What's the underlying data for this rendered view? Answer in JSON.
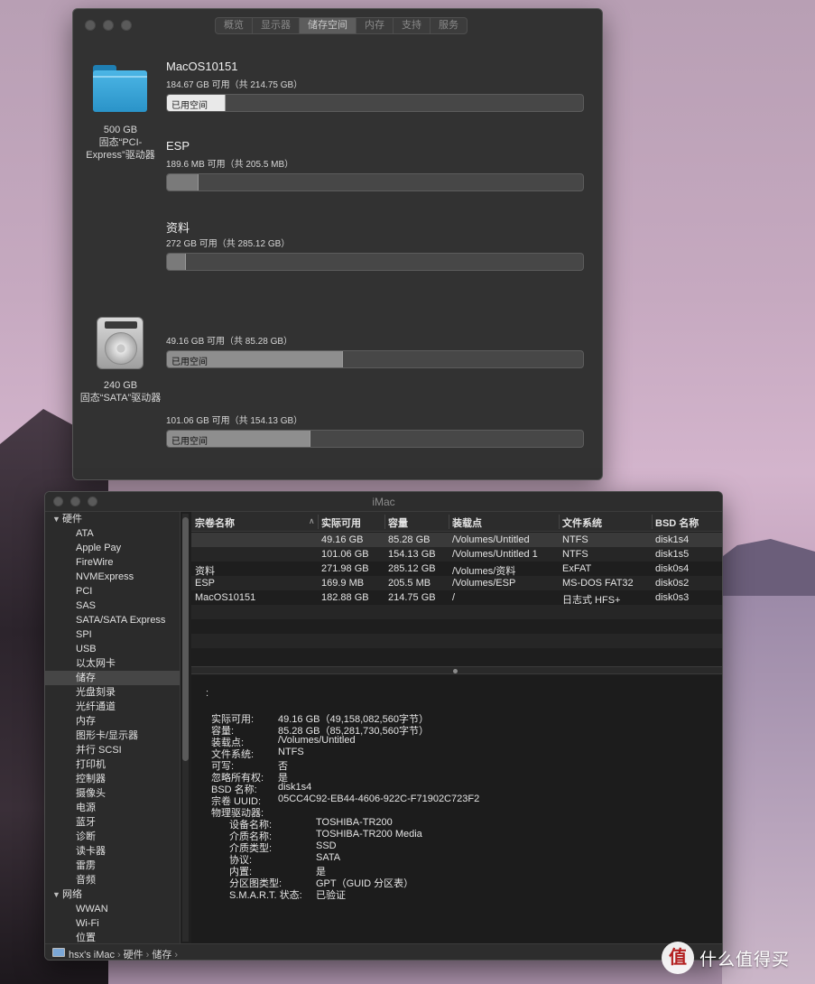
{
  "about": {
    "tabs": [
      "概览",
      "显示器",
      "储存空间",
      "内存",
      "支持",
      "服务"
    ],
    "active_tab": "储存空间",
    "drives": [
      {
        "caption_lines": [
          "500 GB",
          "固态“PCI-",
          "Express”驱动器"
        ],
        "icon": "folder-icon",
        "volumes": [
          {
            "name": "MacOS10151",
            "available": "184.67 GB 可用（共 214.75 GB）",
            "used_label": "已用空间",
            "used_fraction": 0.14
          },
          {
            "name": "ESP",
            "available": "189.6 MB 可用（共 205.5 MB）",
            "used_label": "",
            "used_fraction": 0.077
          },
          {
            "name": "资料",
            "available": "272 GB 可用（共 285.12 GB）",
            "used_label": "",
            "used_fraction": 0.046
          }
        ]
      },
      {
        "caption_lines": [
          "240 GB",
          "固态“SATA”驱动器"
        ],
        "icon": "hard-drive-icon",
        "volumes": [
          {
            "name": "",
            "available": "49.16 GB 可用（共 85.28 GB）",
            "used_label": "已用空间",
            "used_fraction": 0.424
          },
          {
            "name": "",
            "available": "101.06 GB 可用（共 154.13 GB）",
            "used_label": "已用空间",
            "used_fraction": 0.344
          }
        ]
      }
    ]
  },
  "sysinfo": {
    "title": "iMac",
    "sidebar": [
      {
        "label": "硬件",
        "type": "group"
      },
      {
        "label": "ATA",
        "type": "item"
      },
      {
        "label": "Apple Pay",
        "type": "item"
      },
      {
        "label": "FireWire",
        "type": "item"
      },
      {
        "label": "NVMExpress",
        "type": "item"
      },
      {
        "label": "PCI",
        "type": "item"
      },
      {
        "label": "SAS",
        "type": "item"
      },
      {
        "label": "SATA/SATA Express",
        "type": "item"
      },
      {
        "label": "SPI",
        "type": "item"
      },
      {
        "label": "USB",
        "type": "item"
      },
      {
        "label": "以太网卡",
        "type": "item"
      },
      {
        "label": "储存",
        "type": "item",
        "selected": true
      },
      {
        "label": "光盘刻录",
        "type": "item"
      },
      {
        "label": "光纤通道",
        "type": "item"
      },
      {
        "label": "内存",
        "type": "item"
      },
      {
        "label": "图形卡/显示器",
        "type": "item"
      },
      {
        "label": "并行 SCSI",
        "type": "item"
      },
      {
        "label": "打印机",
        "type": "item"
      },
      {
        "label": "控制器",
        "type": "item"
      },
      {
        "label": "摄像头",
        "type": "item"
      },
      {
        "label": "电源",
        "type": "item"
      },
      {
        "label": "蓝牙",
        "type": "item"
      },
      {
        "label": "诊断",
        "type": "item"
      },
      {
        "label": "读卡器",
        "type": "item"
      },
      {
        "label": "雷雳",
        "type": "item"
      },
      {
        "label": "音频",
        "type": "item"
      },
      {
        "label": "网络",
        "type": "group"
      },
      {
        "label": "WWAN",
        "type": "item"
      },
      {
        "label": "Wi-Fi",
        "type": "item"
      },
      {
        "label": "位置",
        "type": "item"
      }
    ],
    "table": {
      "columns": [
        "宗卷名称",
        "实际可用",
        "容量",
        "装载点",
        "文件系统",
        "BSD 名称"
      ],
      "rows": [
        [
          "",
          "49.16 GB",
          "85.28 GB",
          "/Volumes/Untitled",
          "NTFS",
          "disk1s4"
        ],
        [
          "",
          "101.06 GB",
          "154.13 GB",
          "/Volumes/Untitled 1",
          "NTFS",
          "disk1s5"
        ],
        [
          "资料",
          "271.98 GB",
          "285.12 GB",
          "/Volumes/资料",
          "ExFAT",
          "disk0s4"
        ],
        [
          "ESP",
          "169.9 MB",
          "205.5 MB",
          "/Volumes/ESP",
          "MS-DOS FAT32",
          "disk0s2"
        ],
        [
          "MacOS10151",
          "182.88 GB",
          "214.75 GB",
          "/",
          "日志式 HFS+",
          "disk0s3"
        ]
      ],
      "selected_row": 0
    },
    "detail": {
      "heading": ":",
      "fields": [
        [
          "实际可用:",
          "49.16 GB（49,158,082,560字节）"
        ],
        [
          "容量:",
          "85.28 GB（85,281,730,560字节）"
        ],
        [
          "装载点:",
          "/Volumes/Untitled"
        ],
        [
          "文件系统:",
          "NTFS"
        ],
        [
          "可写:",
          "否"
        ],
        [
          "忽略所有权:",
          "是"
        ],
        [
          "BSD 名称:",
          "disk1s4"
        ],
        [
          "宗卷 UUID:",
          "05CC4C92-EB44-4606-922C-F71902C723F2"
        ],
        [
          "物理驱动器:",
          ""
        ]
      ],
      "physical": [
        [
          "设备名称:",
          "TOSHIBA-TR200"
        ],
        [
          "介质名称:",
          "TOSHIBA-TR200 Media"
        ],
        [
          "介质类型:",
          "SSD"
        ],
        [
          "协议:",
          "SATA"
        ],
        [
          "内置:",
          "是"
        ],
        [
          "分区图类型:",
          "GPT（GUID 分区表）"
        ],
        [
          "S.M.A.R.T. 状态:",
          "已验证"
        ]
      ]
    },
    "breadcrumb": [
      "hsx's iMac",
      "硬件",
      "储存"
    ]
  },
  "watermark": {
    "logo_text": "值",
    "text": "什么值得买"
  }
}
